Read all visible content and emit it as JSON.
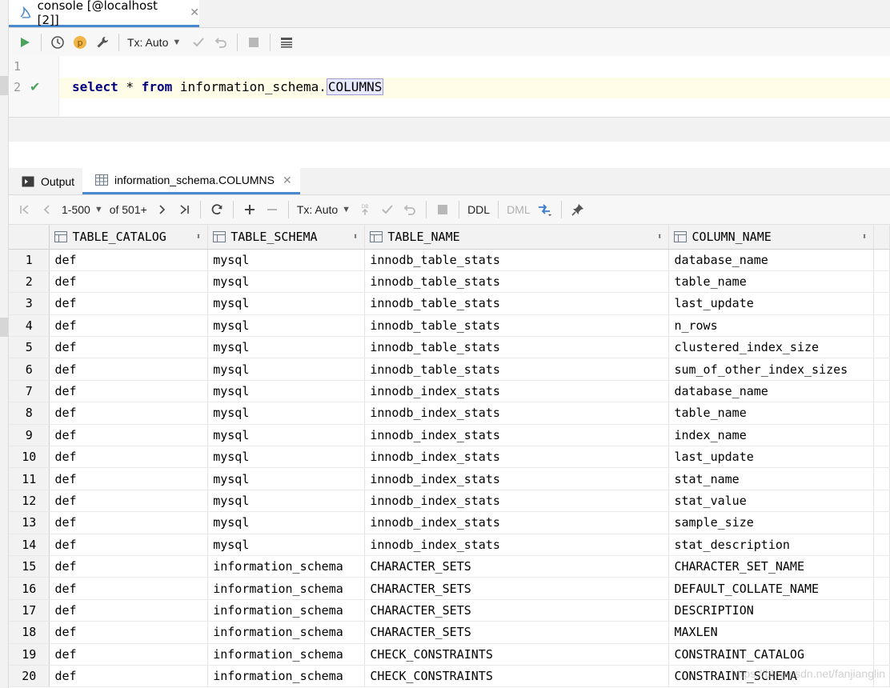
{
  "window": {
    "tab_label": "console [@localhost [2]]"
  },
  "toolbar": {
    "tx_mode": "Tx: Auto"
  },
  "editor": {
    "line_numbers": [
      "1",
      "2"
    ],
    "code": {
      "kw_select": "select",
      "star": " * ",
      "kw_from": "from",
      "space": " ",
      "schema": "information_schema.",
      "table": "COLUMNS"
    }
  },
  "results": {
    "tabs": [
      {
        "label": "Output"
      },
      {
        "label": "information_schema.COLUMNS"
      }
    ],
    "toolbar": {
      "range": "1-500",
      "total": "of 501+",
      "tx_mode": "Tx: Auto",
      "ddl": "DDL",
      "dml": "DML",
      "db_glyph": "DB"
    },
    "columns": [
      "TABLE_CATALOG",
      "TABLE_SCHEMA",
      "TABLE_NAME",
      "COLUMN_NAME"
    ],
    "rows": [
      [
        "1",
        "def",
        "mysql",
        "innodb_table_stats",
        "database_name"
      ],
      [
        "2",
        "def",
        "mysql",
        "innodb_table_stats",
        "table_name"
      ],
      [
        "3",
        "def",
        "mysql",
        "innodb_table_stats",
        "last_update"
      ],
      [
        "4",
        "def",
        "mysql",
        "innodb_table_stats",
        "n_rows"
      ],
      [
        "5",
        "def",
        "mysql",
        "innodb_table_stats",
        "clustered_index_size"
      ],
      [
        "6",
        "def",
        "mysql",
        "innodb_table_stats",
        "sum_of_other_index_sizes"
      ],
      [
        "7",
        "def",
        "mysql",
        "innodb_index_stats",
        "database_name"
      ],
      [
        "8",
        "def",
        "mysql",
        "innodb_index_stats",
        "table_name"
      ],
      [
        "9",
        "def",
        "mysql",
        "innodb_index_stats",
        "index_name"
      ],
      [
        "10",
        "def",
        "mysql",
        "innodb_index_stats",
        "last_update"
      ],
      [
        "11",
        "def",
        "mysql",
        "innodb_index_stats",
        "stat_name"
      ],
      [
        "12",
        "def",
        "mysql",
        "innodb_index_stats",
        "stat_value"
      ],
      [
        "13",
        "def",
        "mysql",
        "innodb_index_stats",
        "sample_size"
      ],
      [
        "14",
        "def",
        "mysql",
        "innodb_index_stats",
        "stat_description"
      ],
      [
        "15",
        "def",
        "information_schema",
        "CHARACTER_SETS",
        "CHARACTER_SET_NAME"
      ],
      [
        "16",
        "def",
        "information_schema",
        "CHARACTER_SETS",
        "DEFAULT_COLLATE_NAME"
      ],
      [
        "17",
        "def",
        "information_schema",
        "CHARACTER_SETS",
        "DESCRIPTION"
      ],
      [
        "18",
        "def",
        "information_schema",
        "CHARACTER_SETS",
        "MAXLEN"
      ],
      [
        "19",
        "def",
        "information_schema",
        "CHECK_CONSTRAINTS",
        "CONSTRAINT_CATALOG"
      ],
      [
        "20",
        "def",
        "information_schema",
        "CHECK_CONSTRAINTS",
        "CONSTRAINT_SCHEMA"
      ]
    ]
  },
  "watermark": "https://blog.csdn.net/fanjianglin",
  "colors": {
    "accent": "#4a88d0",
    "run_green": "#49a35c",
    "keyword": "#000080"
  }
}
